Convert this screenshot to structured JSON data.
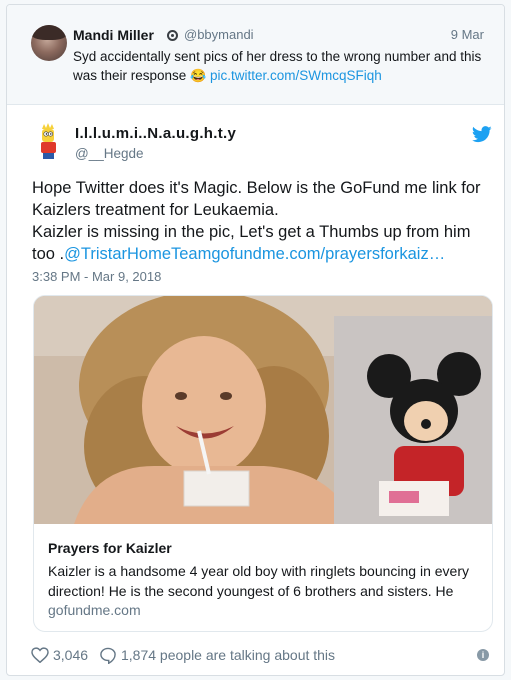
{
  "quoted_tweet": {
    "name": "Mandi Miller",
    "handle": "@bbymandi",
    "date": "9 Mar",
    "text_before": "Syd accidentally sent pics of her dress to the wrong number and this was their response ",
    "emoji": "😂",
    "link": "pic.twitter.com/SWmcqSFiqh"
  },
  "tweet": {
    "author_name": "I.l.l.u.m.i..N.a.u.g.h.t.y",
    "author_handle": "@__Hegde",
    "line1": "Hope Twitter does it's Magic. Below is the GoFund me link for Kaizlers treatment for Leukaemia.",
    "line2": "Kaizler is missing in the pic, Let's get a Thumbs up from him too .",
    "link": "@TristarHomeTeamgofundme.com/prayersforkaiz…",
    "timestamp": "3:38 PM - Mar 9, 2018"
  },
  "link_card": {
    "title": "Prayers for Kaizler",
    "description": "Kaizler is a handsome 4 year old boy with ringlets bouncing in every direction! He is the second youngest of 6 brothers and sisters. He",
    "domain": "gofundme.com"
  },
  "footer": {
    "likes": "3,046",
    "talking": "1,874 people are talking about this"
  },
  "colors": {
    "link": "#1b95e0",
    "muted": "#657786",
    "text": "#14171a"
  },
  "icons": [
    "verified-icon",
    "twitter-bird-icon",
    "heart-icon",
    "comment-icon",
    "info-icon"
  ]
}
